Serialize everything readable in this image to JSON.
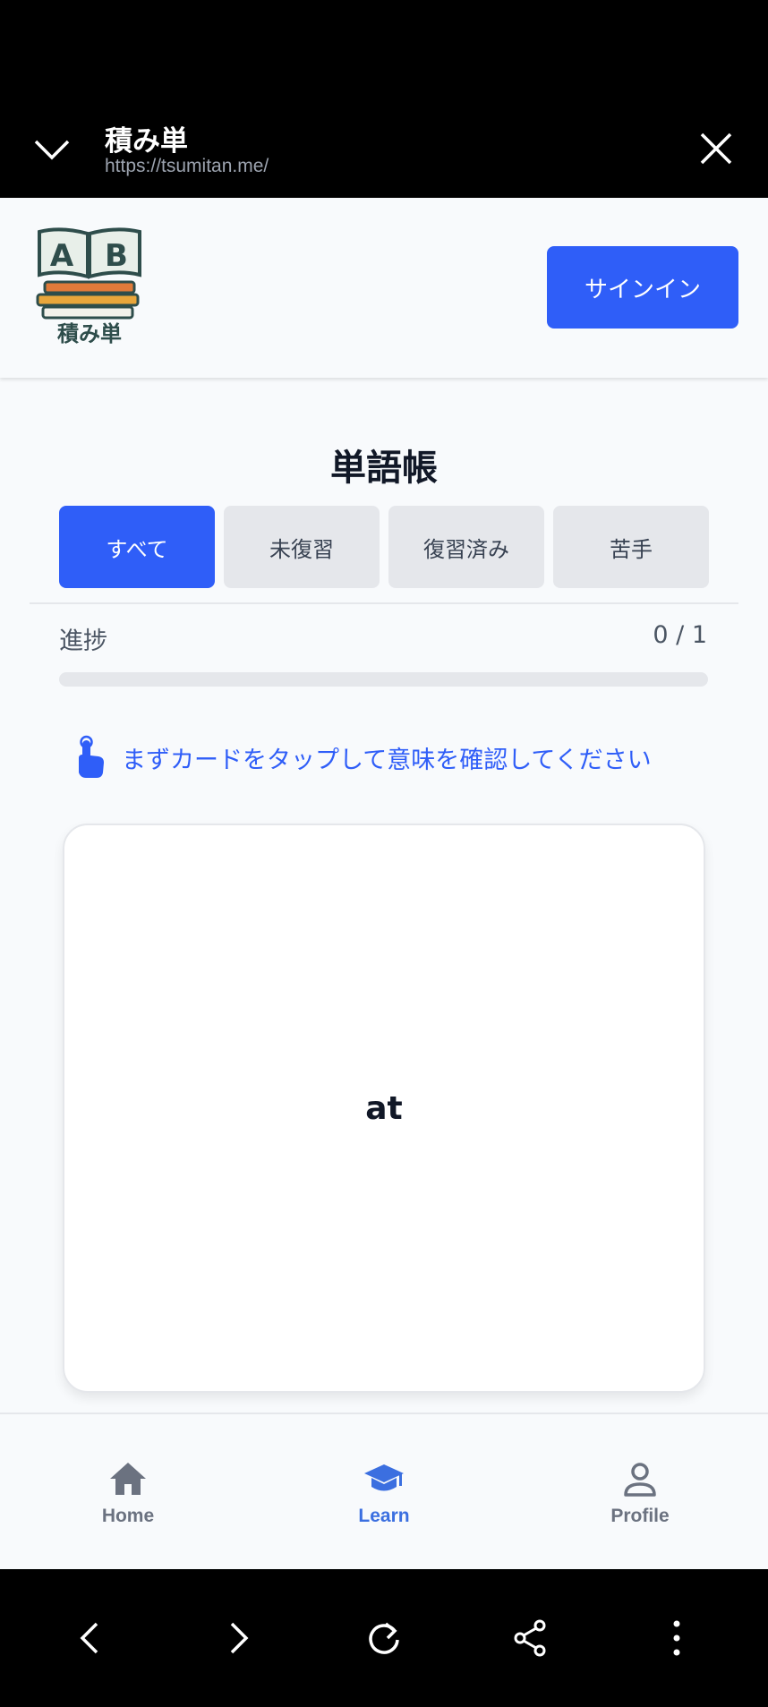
{
  "browser": {
    "site_title": "積み単",
    "site_url": "https://tsumitan.me/"
  },
  "header": {
    "logo_letters": "AB",
    "logo_text": "積み単",
    "signin_label": "サインイン"
  },
  "main": {
    "title": "単語帳",
    "tabs": [
      {
        "label": "すべて",
        "active": true
      },
      {
        "label": "未復習",
        "active": false
      },
      {
        "label": "復習済み",
        "active": false
      },
      {
        "label": "苦手",
        "active": false
      }
    ],
    "progress": {
      "label": "進捗",
      "count": "0 / 1",
      "fraction": 0.0
    },
    "hint": "まずカードをタップして意味を確認してください",
    "card_word": "at"
  },
  "bottom_nav": {
    "items": [
      {
        "label": "Home",
        "icon": "home-icon",
        "active": false
      },
      {
        "label": "Learn",
        "icon": "graduation-cap-icon",
        "active": true
      },
      {
        "label": "Profile",
        "icon": "user-icon",
        "active": false
      }
    ]
  },
  "colors": {
    "accent": "#2f5ef8",
    "nav_active": "#3b6fe0",
    "nav_inactive": "#6b7280"
  }
}
